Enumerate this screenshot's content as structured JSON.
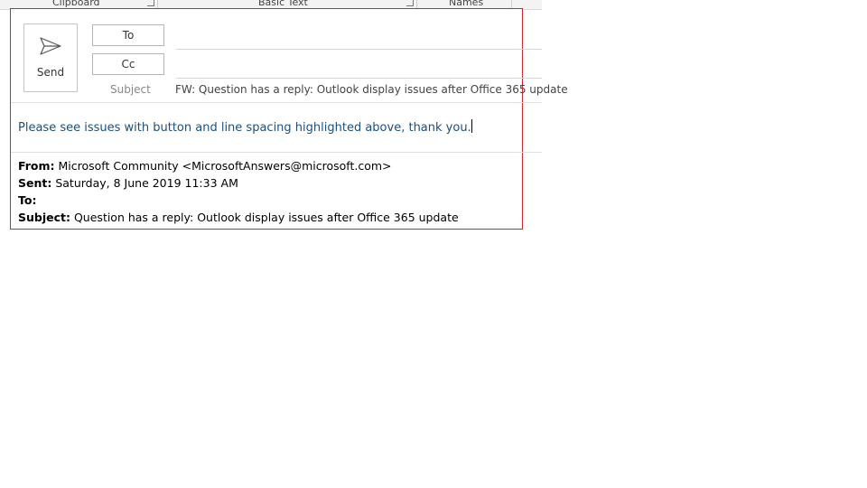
{
  "ribbon": {
    "groups": [
      {
        "label": "Clipboard"
      },
      {
        "label": "Basic Text"
      },
      {
        "label": "Names"
      }
    ]
  },
  "compose": {
    "send_label": "Send",
    "to_label": "To",
    "cc_label": "Cc",
    "to_value": "",
    "cc_value": "",
    "subject_label": "Subject",
    "subject_value": "FW: Question has a reply: Outlook display issues after Office 365 update",
    "body_text": "Please see issues with button and line spacing highlighted above, thank you."
  },
  "forwarded": {
    "from_label": "From:",
    "from_value": " Microsoft Community <MicrosoftAnswers@microsoft.com>",
    "sent_label": "Sent:",
    "sent_value": " Saturday, 8 June 2019 11:33 AM",
    "to_label": "To:",
    "to_value": "",
    "subject_label": "Subject:",
    "subject_value": " Question has a reply: Outlook display issues after Office 365 update"
  },
  "colors": {
    "highlight_border": "#d2262f",
    "body_text": "#1f4e79"
  },
  "icons": {
    "send": "send-arrow-icon",
    "dialog_launcher": "dialog-launcher-icon"
  }
}
